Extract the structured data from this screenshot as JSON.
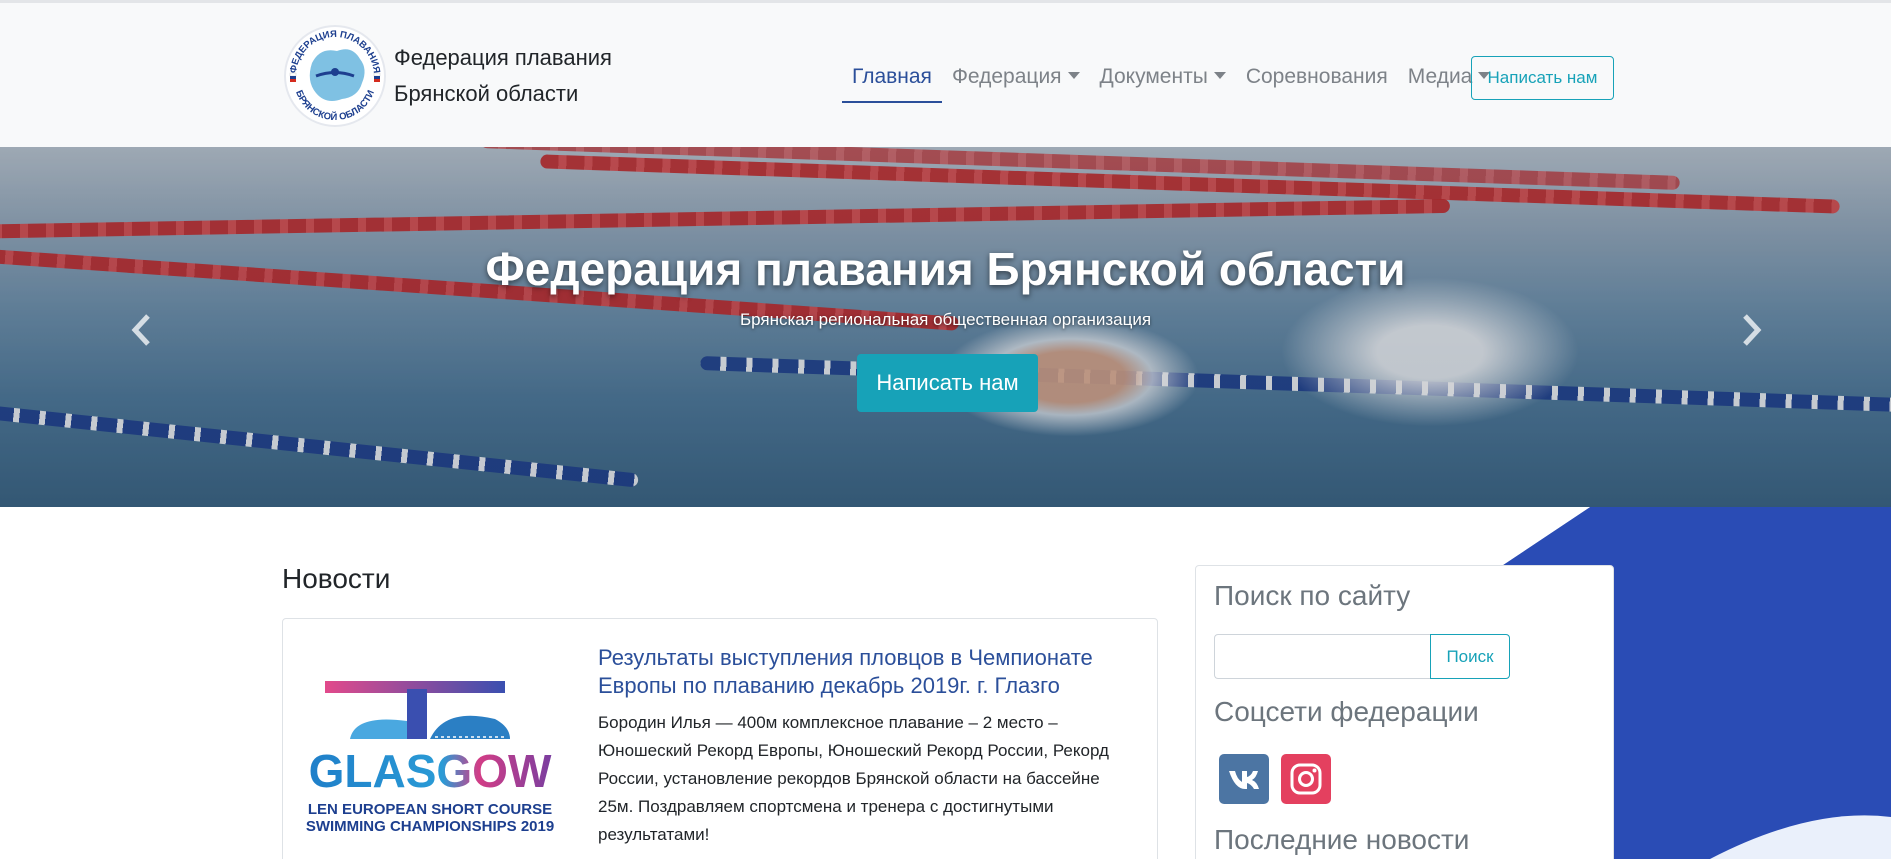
{
  "header": {
    "brand_title": "Федерация плавания Брянской области",
    "logo_text_top": "ФЕДЕРАЦИЯ ПЛАВАНИЯ",
    "logo_text_bottom": "БРЯНСКОЙ ОБЛАСТИ",
    "nav": [
      {
        "label": "Главная",
        "active": true,
        "dropdown": false
      },
      {
        "label": "Федерация",
        "active": false,
        "dropdown": true
      },
      {
        "label": "Документы",
        "active": false,
        "dropdown": true
      },
      {
        "label": "Соревнования",
        "active": false,
        "dropdown": false
      },
      {
        "label": "Медиа",
        "active": false,
        "dropdown": true
      }
    ],
    "cta_label": "Написать нам"
  },
  "hero": {
    "title": "Федерация плавания Брянской области",
    "subtitle": "Брянская региональная общественная организация",
    "button_label": "Написать нам",
    "prev_icon": "chevron-left-icon",
    "next_icon": "chevron-right-icon"
  },
  "news": {
    "heading": "Новости",
    "items": [
      {
        "image_text_main": "GLASGOW",
        "image_text_line1": "LEN EUROPEAN SHORT COURSE",
        "image_text_line2": "SWIMMING CHAMPIONSHIPS 2019",
        "title": "Результаты выступления пловцов в Чемпионате Европы по плаванию декабрь 2019г. г. Глазго",
        "text": "Бородин Илья — 400м комплексное плавание – 2 место – Юношеский Рекорд Европы, Юношеский Рекорд России, Рекорд России, установление рекордов Брянской области на бассейне 25м. Поздравляем спортсмена и тренера с достигнутыми результатами!"
      }
    ]
  },
  "sidebar": {
    "search_heading": "Поиск по сайту",
    "search_value": "",
    "search_button": "Поиск",
    "social_heading": "Соцсети федерации",
    "social": [
      {
        "icon": "vk-icon",
        "color": "#4c75a3"
      },
      {
        "icon": "instagram-icon",
        "color": "#e4405f"
      }
    ],
    "latest_heading": "Последние новости"
  },
  "colors": {
    "primary": "#2b4f9a",
    "accent": "#17a2b8",
    "decor_blue": "#2a4cb5"
  }
}
